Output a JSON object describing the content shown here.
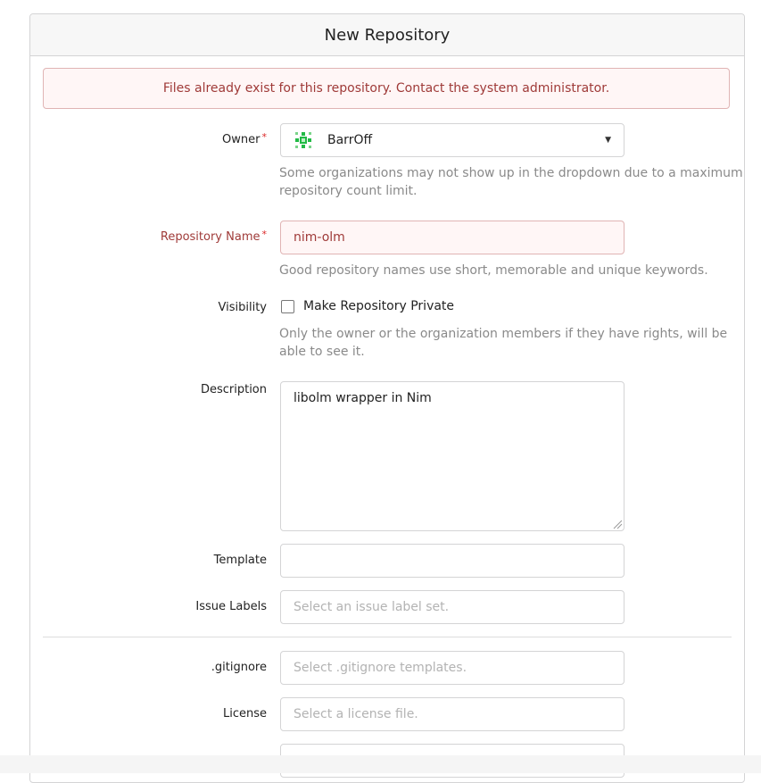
{
  "header": {
    "title": "New Repository"
  },
  "alert": {
    "message": "Files already exist for this repository. Contact the system administrator."
  },
  "owner": {
    "label": "Owner",
    "required_mark": "*",
    "value": "BarrOff",
    "help": "Some organizations may not show up in the dropdown due to a maximum repository count limit."
  },
  "repo_name": {
    "label": "Repository Name",
    "required_mark": "*",
    "value": "nim-olm",
    "help": "Good repository names use short, memorable and unique keywords."
  },
  "visibility": {
    "label": "Visibility",
    "checkbox_label": "Make Repository Private",
    "checked": false,
    "help": "Only the owner or the organization members if they have rights, will be able to see it."
  },
  "description": {
    "label": "Description",
    "value": "libolm wrapper in Nim"
  },
  "template": {
    "label": "Template",
    "value": ""
  },
  "issue_labels": {
    "label": "Issue Labels",
    "placeholder": "Select an issue label set."
  },
  "gitignore": {
    "label": ".gitignore",
    "placeholder": "Select .gitignore templates."
  },
  "license": {
    "label": "License",
    "placeholder": "Select a license file."
  },
  "colors": {
    "error_text": "#9f3a38",
    "error_bg": "#fff6f6",
    "error_border": "#e0b4b4",
    "avatar": "#21ba45"
  }
}
